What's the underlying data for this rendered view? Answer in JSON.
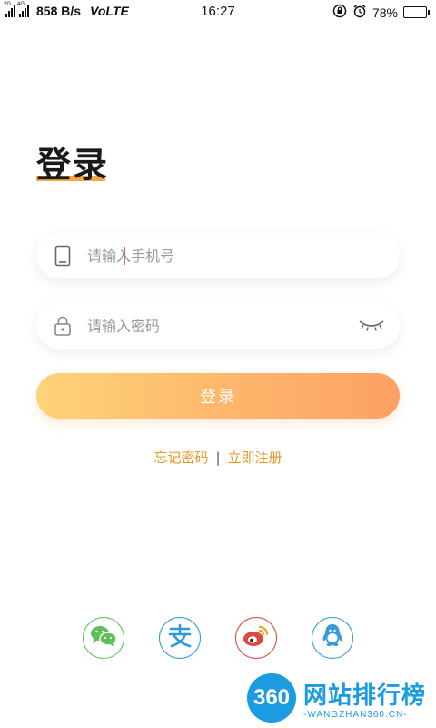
{
  "status_bar": {
    "sim1_label": "2G",
    "sim2_label": "4G",
    "net_speed": "858 B/s",
    "volte": "VoLTE",
    "time": "16:27",
    "battery": "78%",
    "battery_level": 0.78
  },
  "login": {
    "title": "登录",
    "phone_placeholder": "请输入手机号",
    "password_placeholder": "请输入密码",
    "submit_label": "登录",
    "forgot_label": "忘记密码",
    "separator": "|",
    "register_label": "立即注册"
  },
  "social": [
    {
      "name": "wechat-icon",
      "color": "#5ec05a"
    },
    {
      "name": "alipay-icon",
      "color": "#2a9ad8"
    },
    {
      "name": "weibo-icon",
      "color": "#e0473e"
    },
    {
      "name": "qq-icon",
      "color": "#3a9ad9"
    }
  ],
  "watermark": {
    "badge": "360",
    "title": "网站排行榜",
    "subtitle": "-WANGZHAN360.CN-"
  },
  "colors": {
    "accent": "#f5a742",
    "link": "#e69a26",
    "button_start": "#fdd37a",
    "button_end": "#fca163"
  }
}
